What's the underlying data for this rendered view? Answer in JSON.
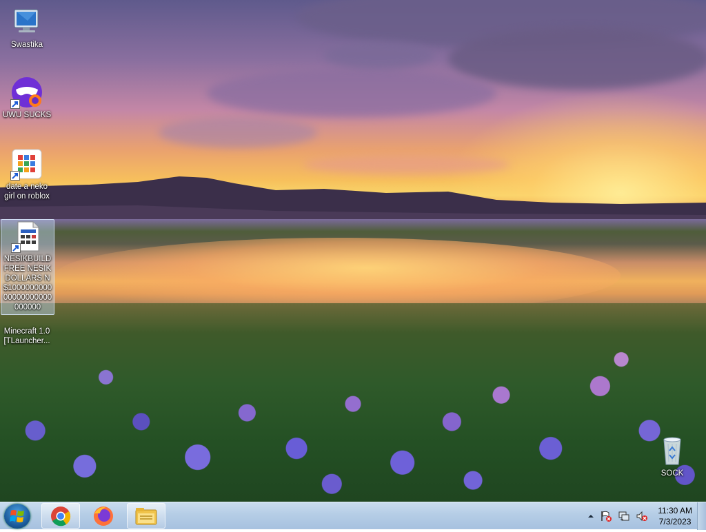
{
  "desktop": {
    "icons": [
      {
        "label": "Swastika"
      },
      {
        "label": "UWU SUCKS"
      },
      {
        "label": "date a neko girl on roblox"
      },
      {
        "label": "NESIKBUILD FREE NESIK DOLLARS N$100000000000000000000000000"
      },
      {
        "label": "Minecraft 1.0 [TLauncher..."
      },
      {
        "label": "SOCK"
      }
    ]
  },
  "taskbar": {
    "clock_time": "11:30 AM",
    "clock_date": "7/3/2023",
    "pinned": [
      "chrome-icon",
      "firefox-icon",
      "file-explorer-icon"
    ]
  },
  "colors": {
    "taskbar_top": "#c9dcee",
    "taskbar_bottom": "#a7c1df",
    "start_orb": "#1d5e9e"
  }
}
